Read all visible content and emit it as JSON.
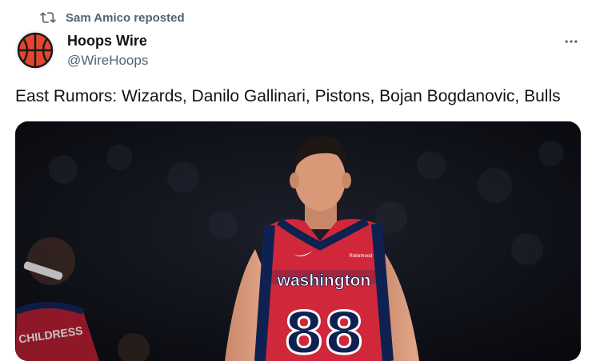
{
  "repost": {
    "icon": "repost-icon",
    "text": "Sam Amico reposted"
  },
  "author": {
    "display_name": "Hoops Wire",
    "handle": "@WireHoops",
    "avatar_icon": "basketball-icon"
  },
  "menu": {
    "icon": "more-icon"
  },
  "tweet": {
    "text": "East Rumors: Wizards, Danilo Gallinari, Pistons, Bojan Bogdanovic, Bulls"
  },
  "media": {
    "jersey_text": "washington",
    "jersey_number": "88",
    "sponsor_text": "Robinhood",
    "background_jersey_text": "CHILDRESS"
  },
  "colors": {
    "text_primary": "#0f1419",
    "text_secondary": "#536471",
    "wizards_red": "#d0283a",
    "wizards_navy": "#0f2150",
    "avatar_bg": "#e2472d"
  }
}
